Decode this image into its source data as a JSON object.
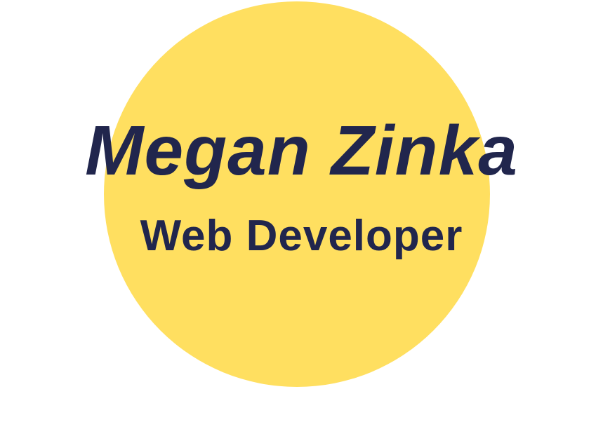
{
  "hero": {
    "name": "Megan Zinka",
    "role": "Web Developer"
  },
  "colors": {
    "background": "#ffffff",
    "circle": "#ffdf60",
    "text": "#21264d"
  }
}
